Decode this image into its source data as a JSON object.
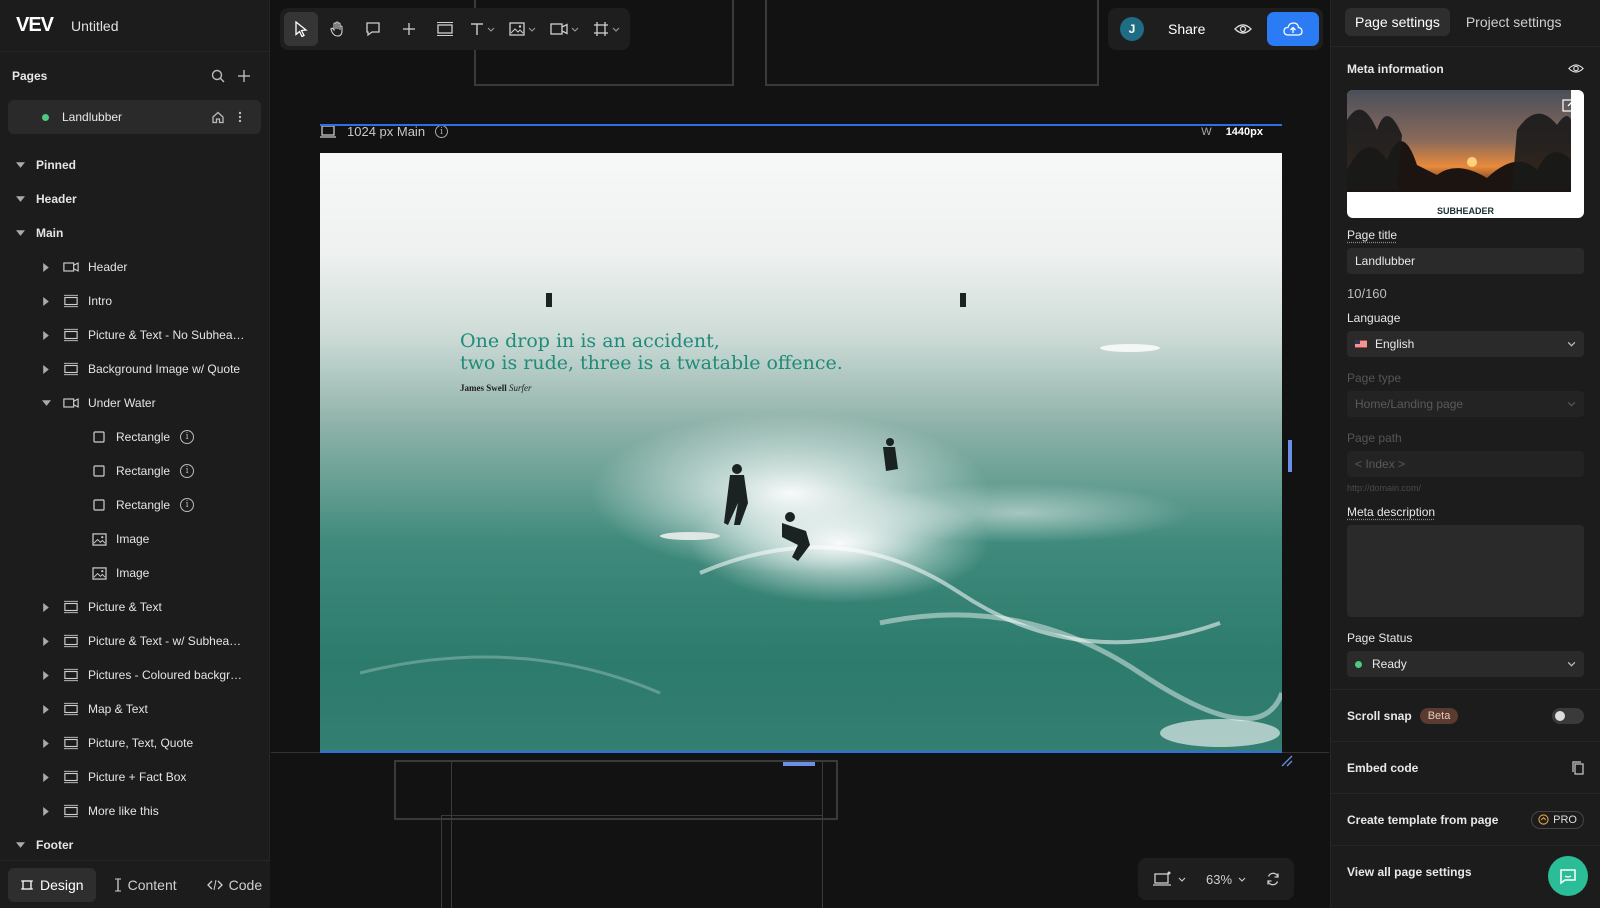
{
  "app": {
    "logo": "VEV",
    "title": "Untitled"
  },
  "sidebar": {
    "pages_label": "Pages",
    "page": {
      "name": "Landlubber",
      "status_color": "#4ec97e"
    },
    "tree": [
      {
        "label": "Pinned",
        "level": 0,
        "icon": ""
      },
      {
        "label": "Header",
        "level": 0,
        "icon": ""
      },
      {
        "label": "Main",
        "level": 0,
        "icon": ""
      },
      {
        "label": "Header",
        "level": 1,
        "icon": "video-icon"
      },
      {
        "label": "Intro",
        "level": 1,
        "icon": "section-icon"
      },
      {
        "label": "Picture & Text - No Subhea…",
        "level": 1,
        "icon": "section-icon"
      },
      {
        "label": "Background Image w/ Quote",
        "level": 1,
        "icon": "section-icon"
      },
      {
        "label": "Under Water",
        "level": 1,
        "icon": "video-icon",
        "expanded": true
      },
      {
        "label": "Rectangle",
        "level": 2,
        "icon": "rectangle-icon",
        "info": true
      },
      {
        "label": "Rectangle",
        "level": 2,
        "icon": "rectangle-icon",
        "info": true
      },
      {
        "label": "Rectangle",
        "level": 2,
        "icon": "rectangle-icon",
        "info": true
      },
      {
        "label": "Image",
        "level": 2,
        "icon": "image-icon"
      },
      {
        "label": "Image",
        "level": 2,
        "icon": "image-icon"
      },
      {
        "label": "Picture & Text",
        "level": 1,
        "icon": "section-icon"
      },
      {
        "label": "Picture & Text - w/ Subhea…",
        "level": 1,
        "icon": "section-icon"
      },
      {
        "label": "Pictures - Coloured backgr…",
        "level": 1,
        "icon": "section-icon"
      },
      {
        "label": "Map & Text",
        "level": 1,
        "icon": "section-icon"
      },
      {
        "label": "Picture, Text, Quote",
        "level": 1,
        "icon": "section-icon"
      },
      {
        "label": "Picture + Fact Box",
        "level": 1,
        "icon": "section-icon"
      },
      {
        "label": "More like this",
        "level": 1,
        "icon": "section-icon"
      },
      {
        "label": "Footer",
        "level": 0,
        "icon": ""
      }
    ],
    "bottom_tabs": {
      "design": "Design",
      "content": "Content",
      "code": "Code"
    }
  },
  "share": {
    "avatar_initial": "J",
    "share_label": "Share",
    "accent": "#2b7bf5"
  },
  "canvas": {
    "frame_label": "1024 px Main",
    "width_label": "W",
    "width_value": "1440px",
    "quote_line1": "One drop in is an accident,",
    "quote_line2": "two is rude, three is a twatable offence.",
    "author_name": "James Swell",
    "author_role": "Surfer"
  },
  "zoom": {
    "value": "63%"
  },
  "panel": {
    "tabs": {
      "page_settings": "Page settings",
      "project_settings": "Project settings"
    },
    "meta_information": "Meta information",
    "thumb_subheader": "SUBHEADER",
    "page_title_label": "Page title",
    "page_title_value": "Landlubber",
    "page_title_count": "10/160",
    "language_label": "Language",
    "language_value": "English",
    "page_type_label": "Page type",
    "page_type_value": "Home/Landing page",
    "page_path_label": "Page path",
    "page_path_placeholder": "< Index >",
    "page_path_hint": "http://domain.com/",
    "meta_description_label": "Meta description",
    "page_status_label": "Page Status",
    "page_status_value": "Ready",
    "scroll_snap_label": "Scroll snap",
    "scroll_snap_badge": "Beta",
    "embed_code_label": "Embed code",
    "create_template_label": "Create template from page",
    "pro_label": "PRO",
    "view_all_label": "View all page settings"
  }
}
